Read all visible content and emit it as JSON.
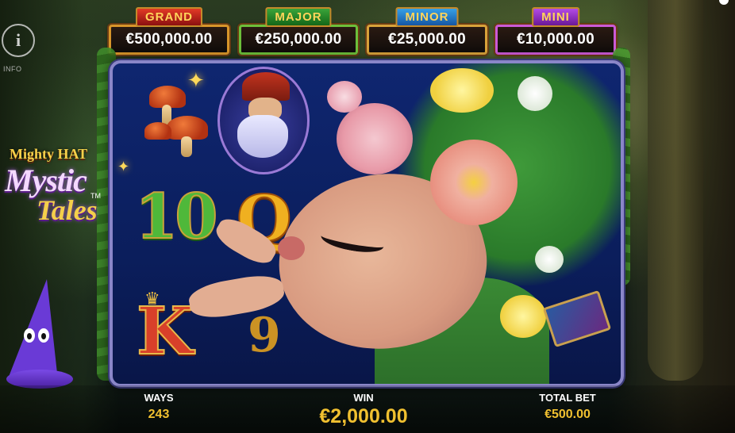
{
  "jackpots": [
    {
      "label": "GRAND",
      "amount": "€500,000.00"
    },
    {
      "label": "MAJOR",
      "amount": "€250,000.00"
    },
    {
      "label": "MINOR",
      "amount": "€25,000.00"
    },
    {
      "label": "MINI",
      "amount": "€10,000.00"
    }
  ],
  "info": {
    "icon": "i",
    "label": "INFO"
  },
  "logo": {
    "line1": "Mighty HAT",
    "line2": "Mystic",
    "line3": "Tales",
    "tm": "TM"
  },
  "symbols": {
    "ten": "10",
    "queen": "Q",
    "king": "K",
    "nine": "9"
  },
  "bottom": {
    "ways_label": "WAYS",
    "ways_value": "243",
    "win_label": "WIN",
    "win_value": "€2,000.00",
    "bet_label": "TOTAL BET",
    "bet_value": "€500.00"
  },
  "colors": {
    "accent": "#f0c030",
    "reel_bg": "#0f2670",
    "frame": "#8a86c8"
  }
}
